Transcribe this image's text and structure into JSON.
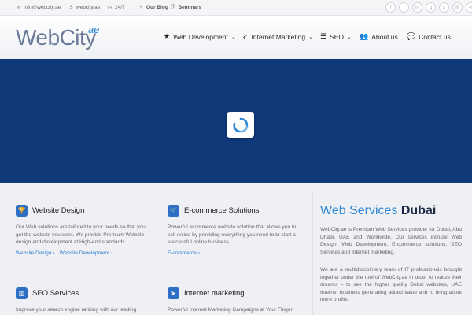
{
  "topbar": {
    "email": "info@webcity.ae",
    "skype": "webcity.ae",
    "hours": "24/7",
    "blog": "Our Blog",
    "seminars": "Seminars",
    "social_icons": [
      "facebook-icon",
      "twitter-icon",
      "linkedin-icon",
      "googleplus-icon",
      "skype-icon",
      "email-icon",
      "link-icon"
    ]
  },
  "header": {
    "logo_text": "WebCity",
    "logo_suffix": "ae",
    "nav": [
      {
        "label": "Web Development",
        "icon": "star-icon",
        "dropdown": true
      },
      {
        "label": "Internet Marketing",
        "icon": "rocket-icon",
        "dropdown": true
      },
      {
        "label": "SEO",
        "icon": "list-icon",
        "dropdown": true
      },
      {
        "label": "About us",
        "icon": "users-icon",
        "dropdown": false
      },
      {
        "label": "Contact us",
        "icon": "chat-icon",
        "dropdown": false
      }
    ]
  },
  "colors": {
    "hero_bg": "#10397a",
    "accent": "#2f86d4",
    "icon_bg": "#2d6fc4"
  },
  "services": [
    {
      "title": "Website Design",
      "icon": "trophy-icon",
      "text": "Our Web solutions are tailored to your needs so that you get the website you want. We provide Premium Website design and development at High-end standards.",
      "links": [
        "Website Design",
        "Website Development"
      ]
    },
    {
      "title": "E-commerce Solutions",
      "icon": "cart-icon",
      "text": "Powerful ecommerce website solution that allows you to sell online by providing everything you need to  to start a successful online business.",
      "links": [
        "E-commerce"
      ]
    },
    {
      "title": "SEO Services",
      "icon": "chart-icon",
      "text": "Improve your search engine ranking with our leading",
      "links": []
    },
    {
      "title": "Internet marketing",
      "icon": "send-icon",
      "text": "Powerful Internet Marketing Campaigns at Your Finger",
      "links": []
    }
  ],
  "web_services": {
    "title_light": "Web Services",
    "title_bold": "Dubai",
    "p1": "WebCity.ae is Premium Web Services provider for Dubai, Abu Dhabi, UAE and Worldwide. Our services include Web Design, Web Development, E-commerce solutions, SEO Services and Internet marketing.",
    "p2": "We are a multidisciplinary team of IT professionals brought together under the roof of WebCity.ae in order to realize their dreams – to see the higher quality Dubai websites, UAE Internet business generating added value and to bring about more profits."
  }
}
